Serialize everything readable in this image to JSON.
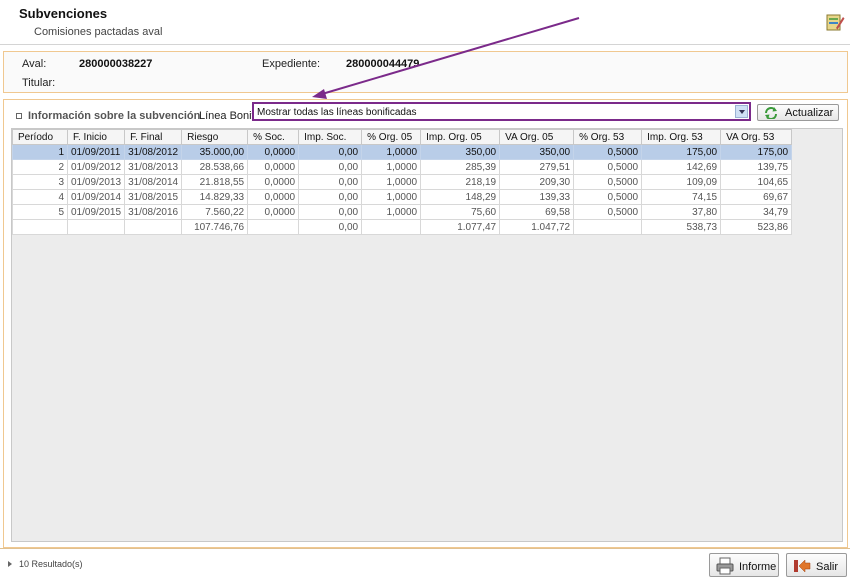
{
  "header": {
    "title": "Subvenciones",
    "subtitle": "Comisiones pactadas aval",
    "icon": "app-edit-icon"
  },
  "info": {
    "aval_label": "Aval:",
    "aval_value": "280000038227",
    "expediente_label": "Expediente:",
    "expediente_value": "280000044479",
    "titular_label": "Titular:"
  },
  "section": {
    "title": "Información sobre la subvención",
    "linea_label": "Línea Bonif.:",
    "linea_value": "Mostrar todas las líneas bonificadas",
    "refresh_label": "Actualizar"
  },
  "table": {
    "headers": [
      "Período",
      "F. Inicio",
      "F. Final",
      "Riesgo",
      "% Soc.",
      "Imp. Soc.",
      "% Org. 05",
      "Imp. Org. 05",
      "VA Org. 05",
      "% Org. 53",
      "Imp. Org. 53",
      "VA Org. 53"
    ],
    "rows": [
      [
        "1",
        "01/09/2011",
        "31/08/2012",
        "35.000,00",
        "0,0000",
        "0,00",
        "1,0000",
        "350,00",
        "350,00",
        "0,5000",
        "175,00",
        "175,00"
      ],
      [
        "2",
        "01/09/2012",
        "31/08/2013",
        "28.538,66",
        "0,0000",
        "0,00",
        "1,0000",
        "285,39",
        "279,51",
        "0,5000",
        "142,69",
        "139,75"
      ],
      [
        "3",
        "01/09/2013",
        "31/08/2014",
        "21.818,55",
        "0,0000",
        "0,00",
        "1,0000",
        "218,19",
        "209,30",
        "0,5000",
        "109,09",
        "104,65"
      ],
      [
        "4",
        "01/09/2014",
        "31/08/2015",
        "14.829,33",
        "0,0000",
        "0,00",
        "1,0000",
        "148,29",
        "139,33",
        "0,5000",
        "74,15",
        "69,67"
      ],
      [
        "5",
        "01/09/2015",
        "31/08/2016",
        "7.560,22",
        "0,0000",
        "0,00",
        "1,0000",
        "75,60",
        "69,58",
        "0,5000",
        "37,80",
        "34,79"
      ]
    ],
    "totals": [
      "",
      "",
      "",
      "107.746,76",
      "",
      "0,00",
      "",
      "1.077,47",
      "1.047,72",
      "",
      "538,73",
      "523,86"
    ],
    "selected_row": 0
  },
  "footer": {
    "results_label": "10 Resultado(s)",
    "informe_label": "Informe",
    "salir_label": "Salir"
  },
  "colors": {
    "annotation": "#7b2a8a",
    "panel_border": "#f0c890",
    "selected_row": "#b9cde8"
  }
}
